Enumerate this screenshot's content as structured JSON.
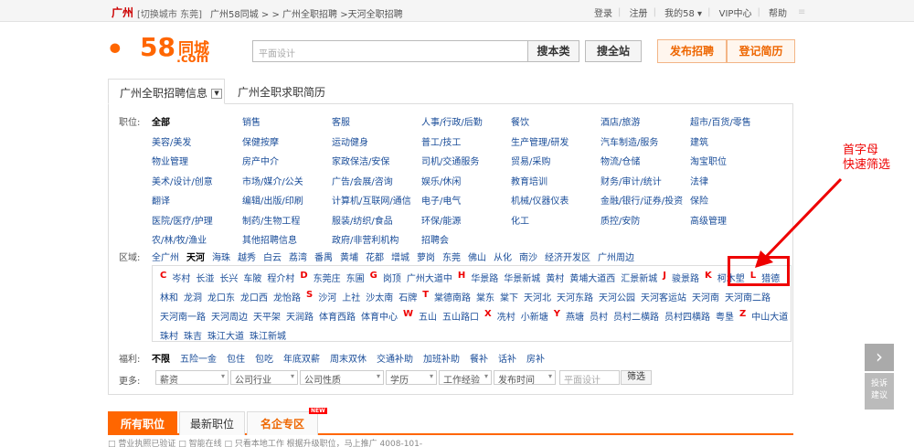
{
  "topbar": {
    "city": "广州",
    "switch": "[切换城市 东莞]",
    "breadcrumb": "广州58同城 > > 广州全职招聘 >天河全职招聘",
    "links": [
      "登录",
      "注册",
      "我的58 ▾",
      "VIP中心",
      "帮助"
    ],
    "more": "≡"
  },
  "logo": {
    "face": "ꔷ",
    "number": "58",
    "cn": "同城",
    "com": ".com"
  },
  "search": {
    "placeholder": "平面设计",
    "btn_this": "搜本类",
    "btn_all": "搜全站",
    "publish": "发布招聘",
    "resume": "登记简历"
  },
  "tabs": {
    "tab1": "广州全职招聘信息",
    "tab1_dd": "▼",
    "tab2": "广州全职求职简历"
  },
  "labels": {
    "position": "职位:",
    "area": "区域:",
    "welfare": "福利:",
    "more": "更多:"
  },
  "categories": [
    [
      "全部",
      "销售",
      "客服",
      "人事/行政/后勤",
      "餐饮",
      "酒店/旅游",
      "超市/百货/零售"
    ],
    [
      "美容/美发",
      "保健按摩",
      "运动健身",
      "普工/技工",
      "生产管理/研发",
      "汽车制造/服务",
      "建筑"
    ],
    [
      "物业管理",
      "房产中介",
      "家政保洁/安保",
      "司机/交通服务",
      "贸易/采购",
      "物流/仓储",
      "淘宝职位"
    ],
    [
      "美术/设计/创意",
      "市场/媒介/公关",
      "广告/会展/咨询",
      "娱乐/休闲",
      "教育培训",
      "财务/审计/统计",
      "法律"
    ],
    [
      "翻译",
      "编辑/出版/印刷",
      "计算机/互联网/通信",
      "电子/电气",
      "机械/仪器仪表",
      "金融/银行/证券/投资",
      "保险"
    ],
    [
      "医院/医疗/护理",
      "制药/生物工程",
      "服装/纺织/食品",
      "环保/能源",
      "化工",
      "质控/安防",
      "高级管理"
    ],
    [
      "农/林/牧/渔业",
      "其他招聘信息",
      "政府/非营利机构",
      "招聘会"
    ]
  ],
  "areas": [
    "全广州",
    "天河",
    "海珠",
    "越秀",
    "白云",
    "荔湾",
    "番禺",
    "黄埔",
    "花都",
    "增城",
    "萝岗",
    "东莞",
    "佛山",
    "从化",
    "南沙",
    "经济开发区",
    "广州周边"
  ],
  "letters": [
    [
      "C",
      "岑村",
      "长湴",
      "长兴",
      "车陂",
      "程介村",
      "D",
      "东莞庄",
      "东圃",
      "G",
      "岗顶",
      "广州大道中",
      "H",
      "华景路",
      "华景新城",
      "黄村",
      "黄埔大道西",
      "汇景新城",
      "J",
      "骏景路",
      "K",
      "柯木塱",
      "L",
      "猎德"
    ],
    [
      "林和",
      "龙洞",
      "龙口东",
      "龙口西",
      "龙怡路",
      "S",
      "沙河",
      "上社",
      "沙太南",
      "石牌",
      "T",
      "棠德南路",
      "棠东",
      "棠下",
      "天河北",
      "天河东路",
      "天河公园",
      "天河客运站",
      "天河南",
      "天河南二路"
    ],
    [
      "天河南一路",
      "天河周边",
      "天平架",
      "天润路",
      "体育西路",
      "体育中心",
      "W",
      "五山",
      "五山路口",
      "X",
      "冼村",
      "小新塘",
      "Y",
      "燕塘",
      "员村",
      "员村二横路",
      "员村四横路",
      "粤垦",
      "Z",
      "中山大道"
    ],
    [
      "珠村",
      "珠吉",
      "珠江大道",
      "珠江新城"
    ]
  ],
  "welfare": [
    "不限",
    "五险一金",
    "包住",
    "包吃",
    "年底双薪",
    "周末双休",
    "交通补助",
    "加班补助",
    "餐补",
    "话补",
    "房补"
  ],
  "filters": {
    "salary": "薪资",
    "industry": "公司行业",
    "nature": "公司性质",
    "edu": "学历",
    "exp": "工作经验",
    "time": "发布时间",
    "keyword": "平面设计",
    "btn": "筛选",
    "caret": "▾"
  },
  "bottom_tabs": [
    "所有职位",
    "最新职位",
    "名企专区"
  ],
  "new_badge": "NEW",
  "bottom_text": "□ 营业执照已验证    □ 智能在线    □ 只看本地工作                              根据升级职位，马上推广 4008-101-"
}
